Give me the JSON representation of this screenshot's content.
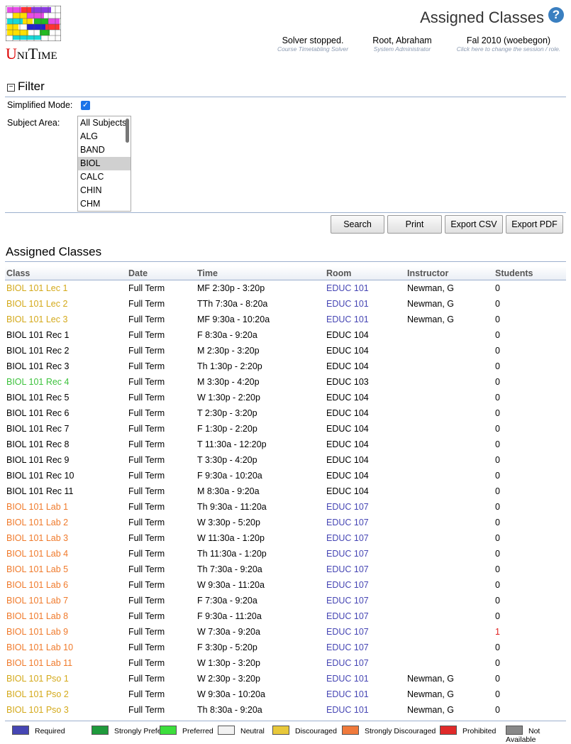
{
  "app": {
    "logo_text": "UniTime"
  },
  "header": {
    "page_title": "Assigned Classes",
    "help_glyph": "?",
    "solver": {
      "main": "Solver stopped.",
      "sub": "Course Timetabling Solver"
    },
    "user": {
      "main": "Root, Abraham",
      "sub": "System Administrator"
    },
    "session": {
      "main": "Fal 2010 (woebegon)",
      "sub": "Click here to change the session / role."
    }
  },
  "filter": {
    "title": "Filter",
    "toggle_glyph": "−",
    "simplified_mode_label": "Simplified Mode:",
    "simplified_mode_checked": true,
    "subject_area_label": "Subject Area:",
    "subject_options": [
      "All Subjects",
      "ALG",
      "BAND",
      "BIOL",
      "CALC",
      "CHIN",
      "CHM"
    ],
    "subject_selected": "BIOL"
  },
  "buttons": {
    "search": "Search",
    "print": "Print",
    "export_csv": "Export CSV",
    "export_pdf": "Export PDF"
  },
  "section_title": "Assigned Classes",
  "table": {
    "columns": [
      "Class",
      "Date",
      "Time",
      "Room",
      "Instructor",
      "Students"
    ],
    "rows": [
      {
        "cls": "BIOL 101 Lec 1",
        "date": "Full Term",
        "time": "MF 2:30p - 3:20p",
        "room": "EDUC 101",
        "instructor": "Newman, G",
        "students": "0",
        "pref": "discouraged",
        "room_pref": "required"
      },
      {
        "cls": "BIOL 101 Lec 2",
        "date": "Full Term",
        "time": "TTh 7:30a - 8:20a",
        "room": "EDUC 101",
        "instructor": "Newman, G",
        "students": "0",
        "pref": "discouraged",
        "room_pref": "required"
      },
      {
        "cls": "BIOL 101 Lec 3",
        "date": "Full Term",
        "time": "MF 9:30a - 10:20a",
        "room": "EDUC 101",
        "instructor": "Newman, G",
        "students": "0",
        "pref": "discouraged",
        "room_pref": "required"
      },
      {
        "cls": "BIOL 101 Rec 1",
        "date": "Full Term",
        "time": "F 8:30a - 9:20a",
        "room": "EDUC 104",
        "instructor": "",
        "students": "0",
        "pref": "neutral",
        "room_pref": "neutral"
      },
      {
        "cls": "BIOL 101 Rec 2",
        "date": "Full Term",
        "time": "M 2:30p - 3:20p",
        "room": "EDUC 104",
        "instructor": "",
        "students": "0",
        "pref": "neutral",
        "room_pref": "neutral"
      },
      {
        "cls": "BIOL 101 Rec 3",
        "date": "Full Term",
        "time": "Th 1:30p - 2:20p",
        "room": "EDUC 104",
        "instructor": "",
        "students": "0",
        "pref": "neutral",
        "room_pref": "neutral"
      },
      {
        "cls": "BIOL 101 Rec 4",
        "date": "Full Term",
        "time": "M 3:30p - 4:20p",
        "room": "EDUC 103",
        "instructor": "",
        "students": "0",
        "pref": "preferred",
        "room_pref": "neutral"
      },
      {
        "cls": "BIOL 101 Rec 5",
        "date": "Full Term",
        "time": "W 1:30p - 2:20p",
        "room": "EDUC 104",
        "instructor": "",
        "students": "0",
        "pref": "neutral",
        "room_pref": "neutral"
      },
      {
        "cls": "BIOL 101 Rec 6",
        "date": "Full Term",
        "time": "T 2:30p - 3:20p",
        "room": "EDUC 104",
        "instructor": "",
        "students": "0",
        "pref": "neutral",
        "room_pref": "neutral"
      },
      {
        "cls": "BIOL 101 Rec 7",
        "date": "Full Term",
        "time": "F 1:30p - 2:20p",
        "room": "EDUC 104",
        "instructor": "",
        "students": "0",
        "pref": "neutral",
        "room_pref": "neutral"
      },
      {
        "cls": "BIOL 101 Rec 8",
        "date": "Full Term",
        "time": "T 11:30a - 12:20p",
        "room": "EDUC 104",
        "instructor": "",
        "students": "0",
        "pref": "neutral",
        "room_pref": "neutral"
      },
      {
        "cls": "BIOL 101 Rec 9",
        "date": "Full Term",
        "time": "T 3:30p - 4:20p",
        "room": "EDUC 104",
        "instructor": "",
        "students": "0",
        "pref": "neutral",
        "room_pref": "neutral"
      },
      {
        "cls": "BIOL 101 Rec 10",
        "date": "Full Term",
        "time": "F 9:30a - 10:20a",
        "room": "EDUC 104",
        "instructor": "",
        "students": "0",
        "pref": "neutral",
        "room_pref": "neutral"
      },
      {
        "cls": "BIOL 101 Rec 11",
        "date": "Full Term",
        "time": "M 8:30a - 9:20a",
        "room": "EDUC 104",
        "instructor": "",
        "students": "0",
        "pref": "neutral",
        "room_pref": "neutral"
      },
      {
        "cls": "BIOL 101 Lab 1",
        "date": "Full Term",
        "time": "Th 9:30a - 11:20a",
        "room": "EDUC 107",
        "instructor": "",
        "students": "0",
        "pref": "strongly-discouraged",
        "room_pref": "required"
      },
      {
        "cls": "BIOL 101 Lab 2",
        "date": "Full Term",
        "time": "W 3:30p - 5:20p",
        "room": "EDUC 107",
        "instructor": "",
        "students": "0",
        "pref": "strongly-discouraged",
        "room_pref": "required"
      },
      {
        "cls": "BIOL 101 Lab 3",
        "date": "Full Term",
        "time": "W 11:30a - 1:20p",
        "room": "EDUC 107",
        "instructor": "",
        "students": "0",
        "pref": "strongly-discouraged",
        "room_pref": "required"
      },
      {
        "cls": "BIOL 101 Lab 4",
        "date": "Full Term",
        "time": "Th 11:30a - 1:20p",
        "room": "EDUC 107",
        "instructor": "",
        "students": "0",
        "pref": "strongly-discouraged",
        "room_pref": "required"
      },
      {
        "cls": "BIOL 101 Lab 5",
        "date": "Full Term",
        "time": "Th 7:30a - 9:20a",
        "room": "EDUC 107",
        "instructor": "",
        "students": "0",
        "pref": "strongly-discouraged",
        "room_pref": "required"
      },
      {
        "cls": "BIOL 101 Lab 6",
        "date": "Full Term",
        "time": "W 9:30a - 11:20a",
        "room": "EDUC 107",
        "instructor": "",
        "students": "0",
        "pref": "strongly-discouraged",
        "room_pref": "required"
      },
      {
        "cls": "BIOL 101 Lab 7",
        "date": "Full Term",
        "time": "F 7:30a - 9:20a",
        "room": "EDUC 107",
        "instructor": "",
        "students": "0",
        "pref": "strongly-discouraged",
        "room_pref": "required"
      },
      {
        "cls": "BIOL 101 Lab 8",
        "date": "Full Term",
        "time": "F 9:30a - 11:20a",
        "room": "EDUC 107",
        "instructor": "",
        "students": "0",
        "pref": "strongly-discouraged",
        "room_pref": "required"
      },
      {
        "cls": "BIOL 101 Lab 9",
        "date": "Full Term",
        "time": "W 7:30a - 9:20a",
        "room": "EDUC 107",
        "instructor": "",
        "students": "1",
        "pref": "strongly-discouraged",
        "room_pref": "required",
        "students_pref": "prohibited"
      },
      {
        "cls": "BIOL 101 Lab 10",
        "date": "Full Term",
        "time": "F 3:30p - 5:20p",
        "room": "EDUC 107",
        "instructor": "",
        "students": "0",
        "pref": "strongly-discouraged",
        "room_pref": "required"
      },
      {
        "cls": "BIOL 101 Lab 11",
        "date": "Full Term",
        "time": "W 1:30p - 3:20p",
        "room": "EDUC 107",
        "instructor": "",
        "students": "0",
        "pref": "strongly-discouraged",
        "room_pref": "required"
      },
      {
        "cls": "BIOL 101 Pso 1",
        "date": "Full Term",
        "time": "W 2:30p - 3:20p",
        "room": "EDUC 101",
        "instructor": "Newman, G",
        "students": "0",
        "pref": "discouraged",
        "room_pref": "required"
      },
      {
        "cls": "BIOL 101 Pso 2",
        "date": "Full Term",
        "time": "W 9:30a - 10:20a",
        "room": "EDUC 101",
        "instructor": "Newman, G",
        "students": "0",
        "pref": "discouraged",
        "room_pref": "required"
      },
      {
        "cls": "BIOL 101 Pso 3",
        "date": "Full Term",
        "time": "Th 8:30a - 9:20a",
        "room": "EDUC 101",
        "instructor": "Newman, G",
        "students": "0",
        "pref": "discouraged",
        "room_pref": "required"
      }
    ]
  },
  "legend": [
    {
      "label": "Required",
      "color": "#4646b4"
    },
    {
      "label": "Strongly Preferred",
      "color": "#1f9a3c"
    },
    {
      "label": "Preferred",
      "color": "#3cde3c"
    },
    {
      "label": "Neutral",
      "color": "#f2f2f2"
    },
    {
      "label": "Discouraged",
      "color": "#e8c83a"
    },
    {
      "label": "Strongly Discouraged",
      "color": "#f07a3c"
    },
    {
      "label": "Prohibited",
      "color": "#e02a2a"
    },
    {
      "label": "Not Available",
      "color": "#888888"
    }
  ]
}
